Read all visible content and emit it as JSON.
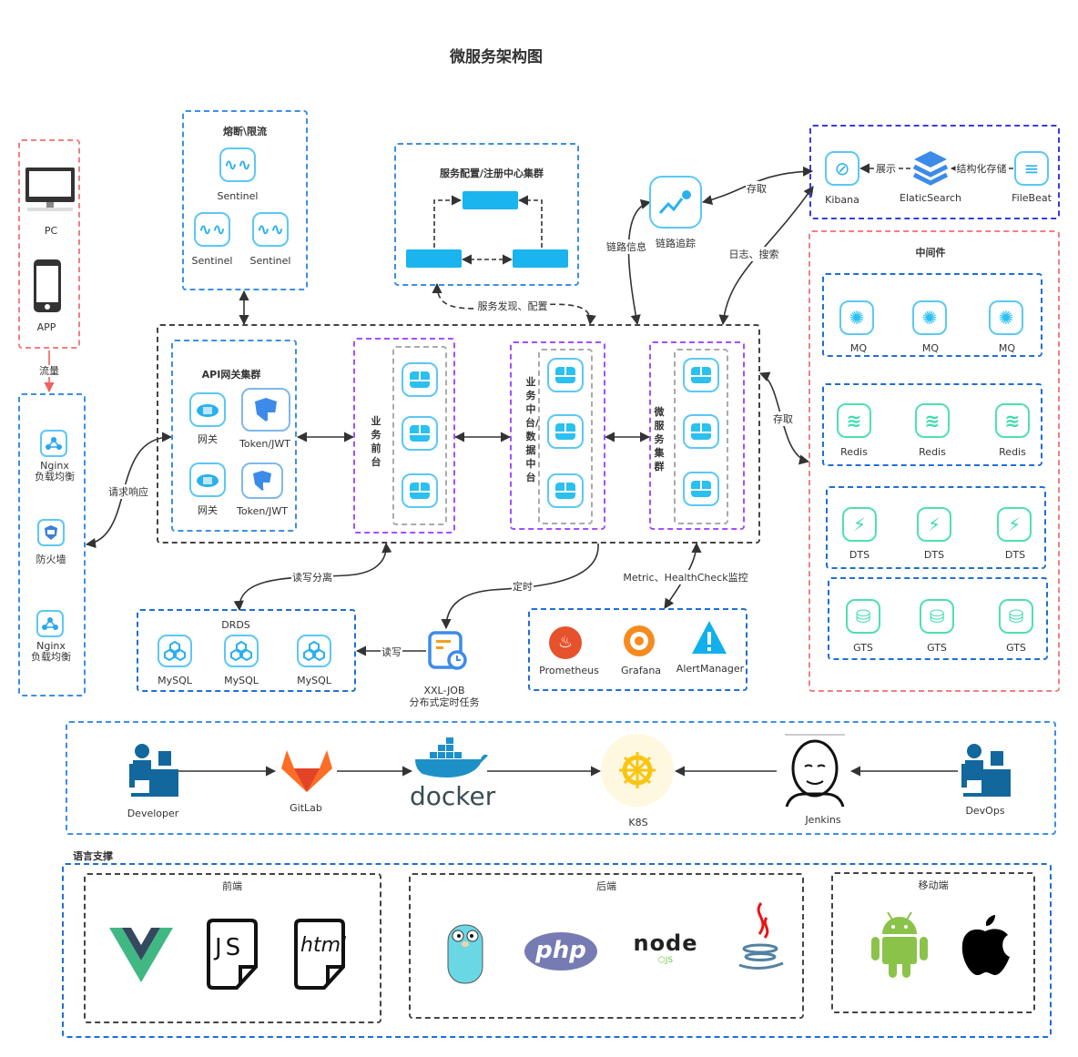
{
  "title": "微服务架构图",
  "clients": {
    "items": [
      {
        "label": "PC",
        "icon": "desktop-icon"
      },
      {
        "label": "APP",
        "icon": "phone-icon"
      }
    ]
  },
  "traffic_label": "流量",
  "edge_nodes": {
    "items": [
      {
        "label": "Nginx",
        "sub": "负载均衡",
        "icon": "load-balancer-icon"
      },
      {
        "label": "防火墙",
        "sub": "",
        "icon": "firewall-icon"
      },
      {
        "label": "Nginx",
        "sub": "负载均衡",
        "icon": "load-balancer-icon"
      }
    ]
  },
  "circuit_breaker": {
    "title": "熔断\\限流",
    "items": [
      "Sentinel",
      "Sentinel",
      "Sentinel"
    ]
  },
  "registry": {
    "title": "服务配置/注册中心集群"
  },
  "tracing": {
    "label": "链路追踪"
  },
  "logging": {
    "items": [
      "Kibana",
      "ElaticSearch",
      "FileBeat"
    ],
    "edge_show": "展示",
    "edge_store": "结构化存储"
  },
  "gateway": {
    "title": "API网关集群",
    "items": [
      "网关",
      "Token/JWT",
      "网关",
      "Token/JWT"
    ]
  },
  "clusters": [
    {
      "title": "业务前台"
    },
    {
      "title": "业务中台/数据中台"
    },
    {
      "title": "微服务集群"
    }
  ],
  "middleware": {
    "title": "中间件",
    "groups": [
      {
        "name": "mq",
        "items": [
          "MQ",
          "MQ",
          "MQ"
        ]
      },
      {
        "name": "redis",
        "items": [
          "Redis",
          "Redis",
          "Redis"
        ]
      },
      {
        "name": "dts",
        "items": [
          "DTS",
          "DTS",
          "DTS"
        ]
      },
      {
        "name": "gts",
        "items": [
          "GTS",
          "GTS",
          "GTS"
        ]
      }
    ]
  },
  "drds": {
    "title": "DRDS",
    "items": [
      "MySQL",
      "MySQL",
      "MySQL"
    ]
  },
  "xxljob": {
    "label": "XXL-JOB",
    "sub": "分布式定时任务"
  },
  "monitor": {
    "items": [
      "Prometheus",
      "Grafana",
      "AlertManager"
    ]
  },
  "edges": {
    "request_response": "请求响应",
    "service_discovery": "服务发现、配置",
    "trace_info": "链路信息",
    "store1": "存取",
    "logs_search": "日志、搜索",
    "store2": "存取",
    "rw_split": "读写分离",
    "schedule": "定时",
    "metric": "Metric、HealthCheck监控",
    "read_write": "读写"
  },
  "cicd": {
    "items": [
      "Developer",
      "GitLab",
      "docker",
      "K8S",
      "Jenkins",
      "DevOps"
    ]
  },
  "languages": {
    "title": "语言支撑",
    "frontend": {
      "title": "前端",
      "items": [
        "Vue",
        "JS",
        "html"
      ]
    },
    "backend": {
      "title": "后端",
      "items": [
        "Go",
        "php",
        "node",
        "Java"
      ]
    },
    "mobile": {
      "title": "移动端",
      "items": [
        "Android",
        "Apple"
      ]
    }
  }
}
